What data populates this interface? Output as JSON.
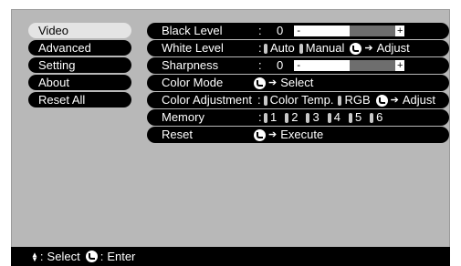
{
  "sidebar": {
    "items": [
      {
        "label": "Video"
      },
      {
        "label": "Advanced"
      },
      {
        "label": "Setting"
      },
      {
        "label": "About"
      },
      {
        "label": "Reset All"
      }
    ]
  },
  "rows": {
    "black_level": {
      "label": "Black Level",
      "colon": ":",
      "value": "0",
      "minus": "-",
      "plus": "+",
      "level": 0.5
    },
    "white_level": {
      "label": "White Level",
      "colon": ":",
      "opt1": "Auto",
      "opt2": "Manual",
      "action": "Adjust"
    },
    "sharpness": {
      "label": "Sharpness",
      "colon": ":",
      "value": "0",
      "minus": "-",
      "plus": "+",
      "level": 0.5
    },
    "color_mode": {
      "label": "Color Mode",
      "action": "Select"
    },
    "color_adjustment": {
      "label": "Color Adjustment",
      "colon": ":",
      "opt1": "Color Temp.",
      "opt2": "RGB",
      "action": "Adjust"
    },
    "memory": {
      "label": "Memory",
      "colon": ":",
      "slots": [
        "1",
        "2",
        "3",
        "4",
        "5",
        "6"
      ]
    },
    "reset": {
      "label": "Reset",
      "action": "Execute"
    }
  },
  "status": {
    "select_label": "Select",
    "enter_label": "Enter",
    "colon": ":"
  },
  "colors": {
    "background": "#b8b8b8",
    "row": "#000000",
    "active_tab": "#e4e4e4",
    "bar": "#6e6e6e"
  },
  "icons": [
    "enter-icon",
    "updown-icon",
    "arrow-right-icon",
    "option-pill-icon"
  ]
}
